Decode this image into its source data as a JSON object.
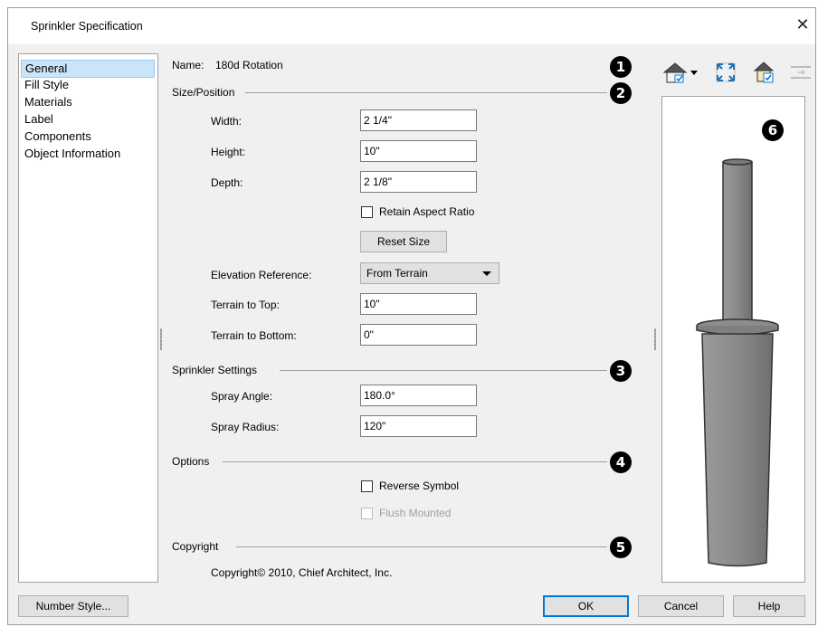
{
  "window": {
    "title": "Sprinkler Specification",
    "close_glyph": "✕"
  },
  "sidebar": {
    "items": [
      {
        "label": "General",
        "selected": true
      },
      {
        "label": "Fill Style",
        "selected": false
      },
      {
        "label": "Materials",
        "selected": false
      },
      {
        "label": "Label",
        "selected": false
      },
      {
        "label": "Components",
        "selected": false
      },
      {
        "label": "Object Information",
        "selected": false
      }
    ]
  },
  "name_row": {
    "label": "Name:",
    "value": "180d Rotation"
  },
  "size_position": {
    "title": "Size/Position",
    "width": {
      "label": "Width:",
      "value": "2 1/4\""
    },
    "height": {
      "label": "Height:",
      "value": "10\""
    },
    "depth": {
      "label": "Depth:",
      "value": "2 1/8\""
    },
    "retain_aspect": {
      "label": "Retain Aspect Ratio",
      "checked": false
    },
    "reset_size": "Reset Size",
    "elevation_ref": {
      "label": "Elevation Reference:",
      "value": "From Terrain"
    },
    "terrain_top": {
      "label": "Terrain to Top:",
      "value": "10\""
    },
    "terrain_bottom": {
      "label": "Terrain to Bottom:",
      "value": "0\""
    }
  },
  "sprinkler_settings": {
    "title": "Sprinkler Settings",
    "spray_angle": {
      "label": "Spray Angle:",
      "value": "180.0°"
    },
    "spray_radius": {
      "label": "Spray Radius:",
      "value": "120\""
    }
  },
  "options": {
    "title": "Options",
    "reverse_symbol": {
      "label": "Reverse Symbol",
      "checked": false
    },
    "flush_mounted": {
      "label": "Flush Mounted",
      "checked": false,
      "enabled": false
    }
  },
  "copyright": {
    "title": "Copyright",
    "text": "Copyright© 2010, Chief Architect, Inc."
  },
  "callouts": [
    "1",
    "2",
    "3",
    "4",
    "5",
    "6"
  ],
  "toolbar": {
    "icons": [
      "camera-view-icon",
      "fit-view-icon",
      "show-ceiling-icon",
      "toggle-view-icon"
    ]
  },
  "footer": {
    "number_style": "Number Style...",
    "ok": "OK",
    "cancel": "Cancel",
    "help": "Help"
  },
  "colors": {
    "selection": "#cce4f7",
    "accent": "#0078d7",
    "preview_model": "#8a8a8a"
  }
}
